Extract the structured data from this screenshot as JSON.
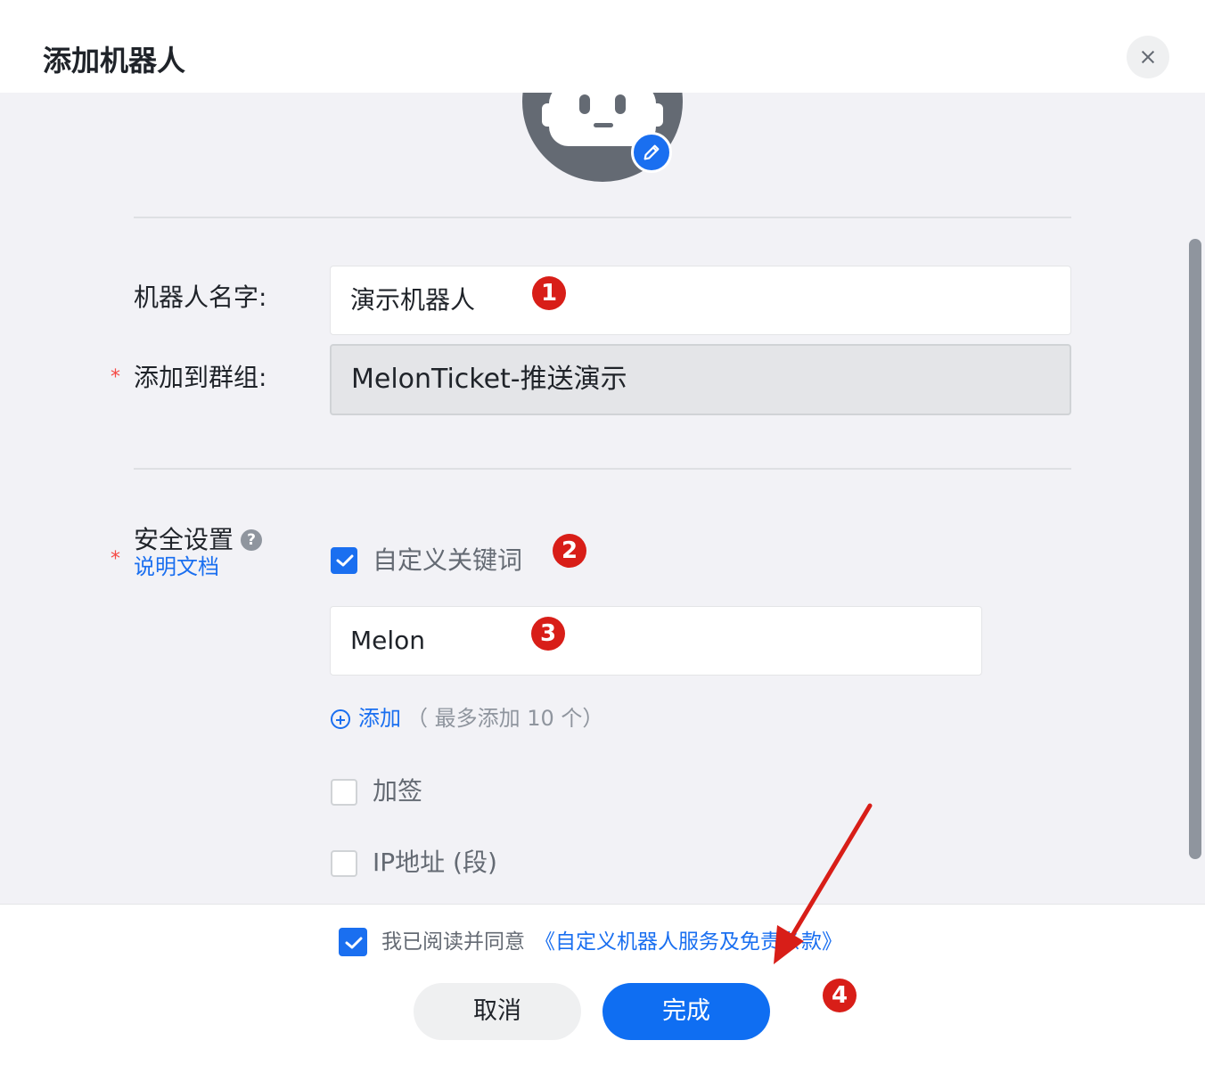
{
  "dialog": {
    "title": "添加机器人"
  },
  "form": {
    "name_label": "机器人名字:",
    "name_value": "演示机器人",
    "group_label": "添加到群组:",
    "group_value": "MelonTicket-推送演示",
    "required_mark": "*"
  },
  "security": {
    "label": "安全设置",
    "help_glyph": "?",
    "doc_link": "说明文档",
    "keyword_option": "自定义关键词",
    "keyword_checked": true,
    "keyword_value": "Melon",
    "add_label": "添加",
    "add_hint": "（ 最多添加 10 个）",
    "sign_option": "加签",
    "sign_checked": false,
    "ip_option": "IP地址 (段)",
    "ip_checked": false
  },
  "footer": {
    "agree_checked": true,
    "agree_text": "我已阅读并同意",
    "agree_link": "《自定义机器人服务及免责条款》",
    "cancel_label": "取消",
    "done_label": "完成"
  },
  "annotations": {
    "step1": "1",
    "step2": "2",
    "step3": "3",
    "step4": "4",
    "marker_color": "#d81e18"
  },
  "colors": {
    "primary": "#0f6ef2",
    "link": "#1a6ff0",
    "required": "#f54a45",
    "panel_bg": "#f2f2f6"
  },
  "icons": {
    "close": "close-icon",
    "edit": "pencil-icon",
    "help": "question-icon",
    "add": "plus-circle-icon",
    "check": "check-icon"
  }
}
